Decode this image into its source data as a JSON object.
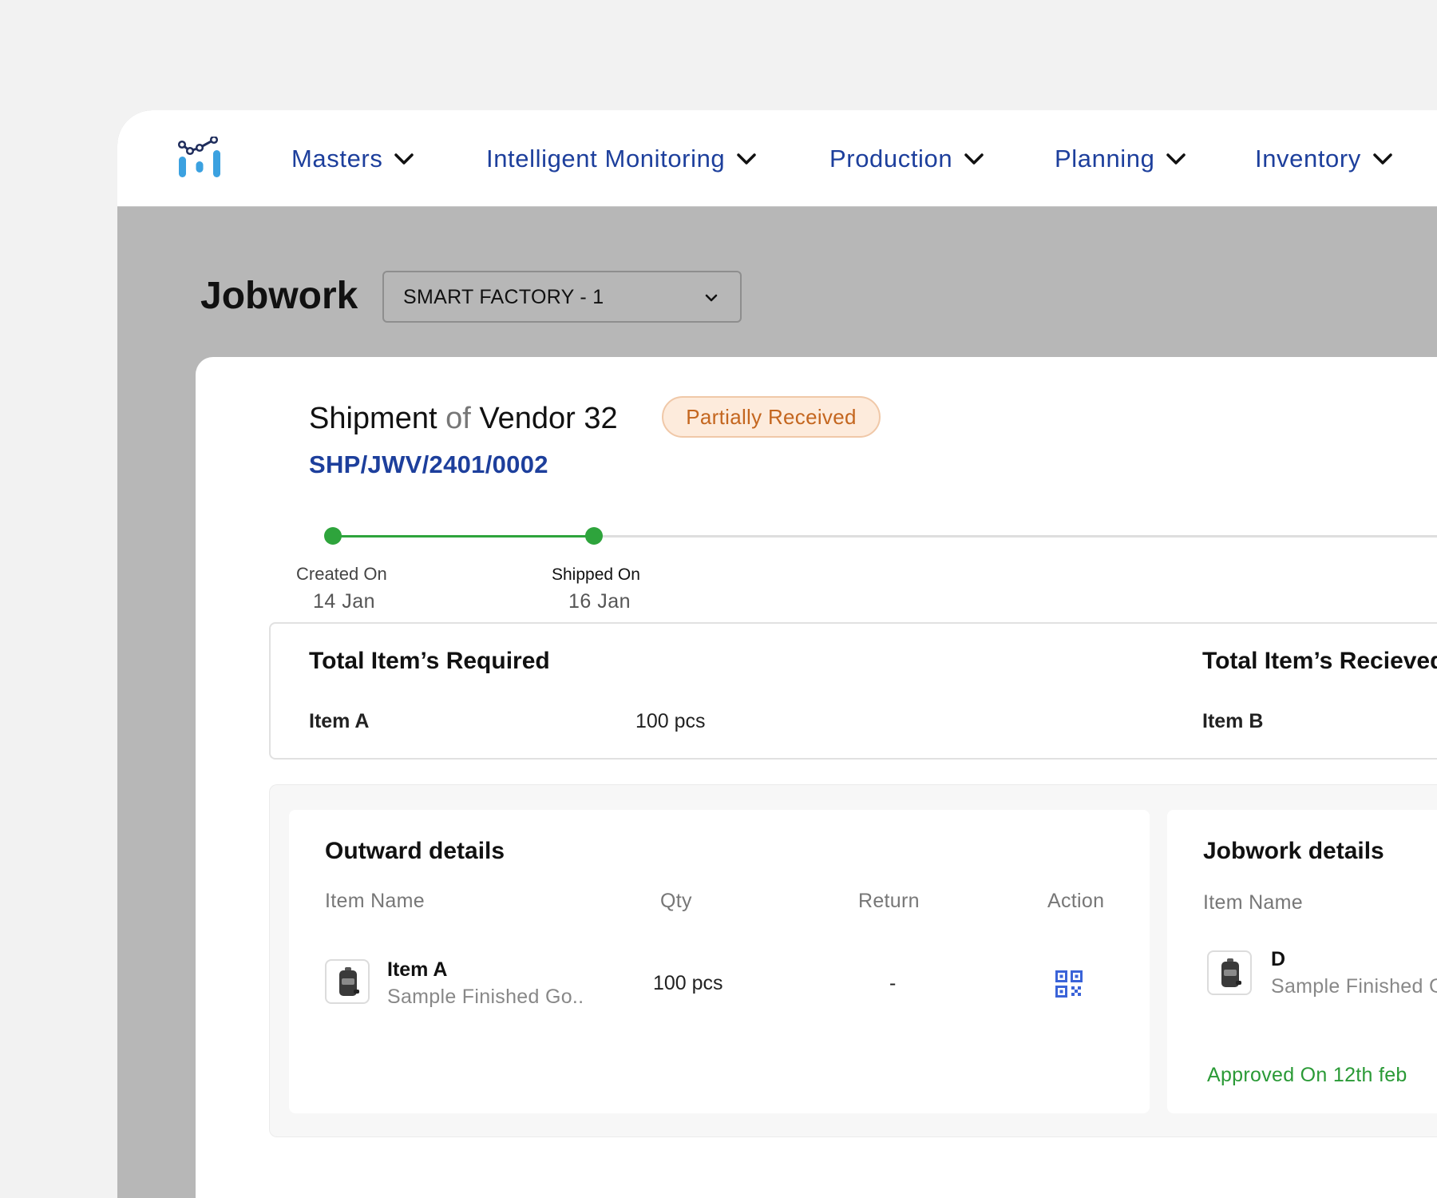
{
  "nav": {
    "items": [
      {
        "label": "Masters"
      },
      {
        "label": "Intelligent Monitoring"
      },
      {
        "label": "Production"
      },
      {
        "label": "Planning"
      },
      {
        "label": "Inventory"
      }
    ]
  },
  "page": {
    "title": "Jobwork",
    "factory_select": "SMART FACTORY - 1"
  },
  "shipment": {
    "title_prefix": "Shipment",
    "title_of": "of",
    "vendor": "Vendor 32",
    "status": "Partially Received",
    "code": "SHP/JWV/2401/0002"
  },
  "timeline": [
    {
      "label": "Created On",
      "date": "14 Jan"
    },
    {
      "label": "Shipped On",
      "date": "16 Jan"
    }
  ],
  "totals": {
    "required_heading": "Total Item’s Required",
    "required_item": "Item A",
    "required_qty": "100 pcs",
    "received_heading": "Total Item’s Recieved",
    "received_item": "Item B"
  },
  "outward": {
    "title": "Outward details",
    "columns": [
      "Item Name",
      "Qty",
      "Return",
      "Action"
    ],
    "row": {
      "name": "Item A",
      "sub": "Sample Finished Go..",
      "qty": "100 pcs",
      "return": "-",
      "action_icon": "qr-code-icon"
    }
  },
  "jobwork": {
    "title": "Jobwork details",
    "columns": [
      "Item Name"
    ],
    "row": {
      "name": "D",
      "sub": "Sample Finished G"
    },
    "approved": "Approved On 12th feb"
  },
  "colors": {
    "brand": "#1d3f9c",
    "success": "#2ea43c",
    "warning_text": "#c4661f",
    "warning_bg": "#fdebdc"
  }
}
